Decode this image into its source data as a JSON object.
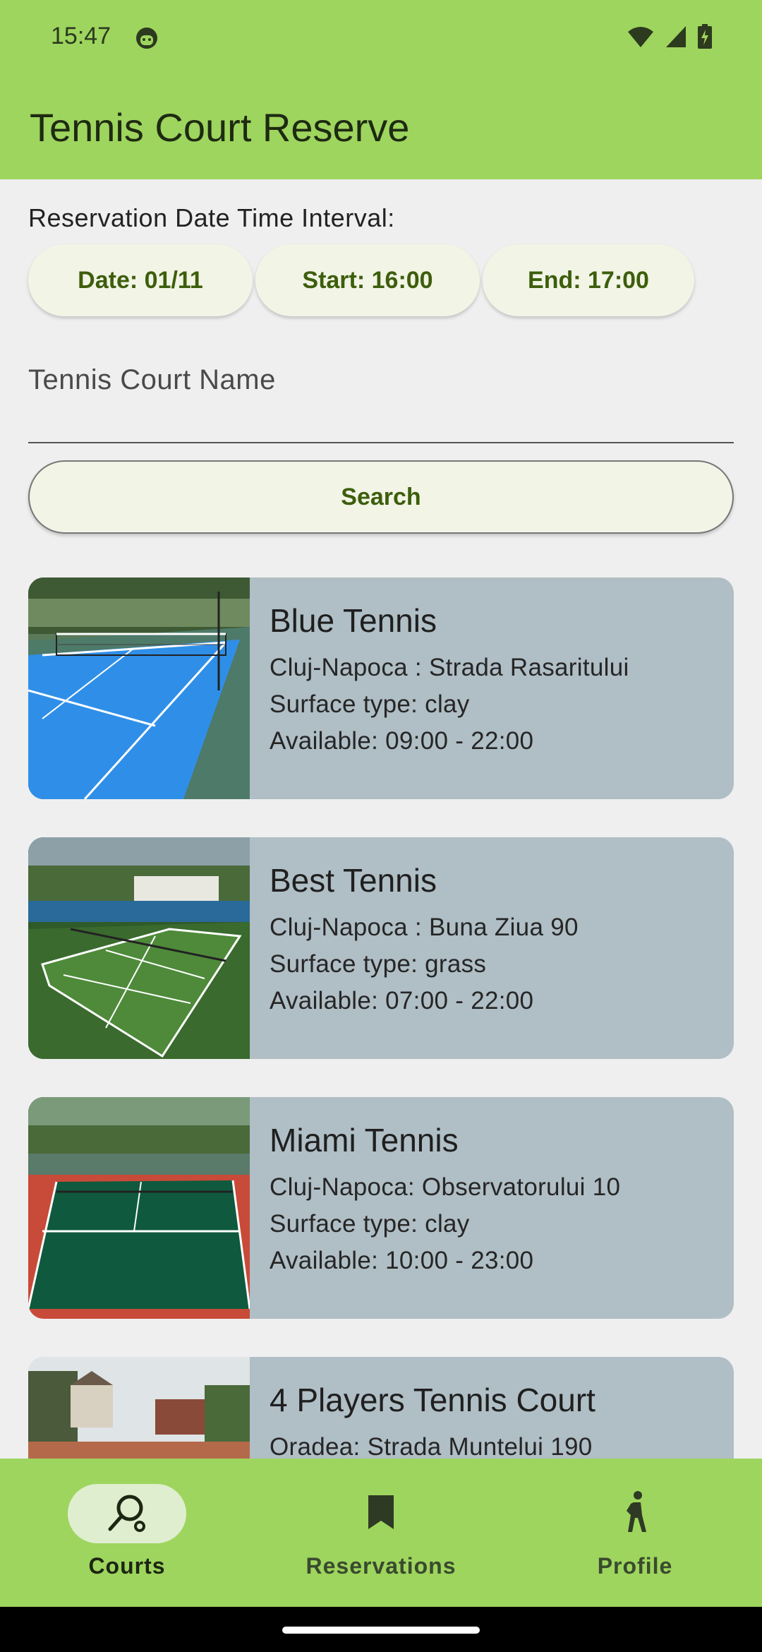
{
  "status_bar": {
    "time": "15:47",
    "icons": [
      "face-icon",
      "wifi-icon",
      "signal-icon",
      "battery-charging-icon"
    ]
  },
  "app_bar": {
    "title": "Tennis Court Reserve"
  },
  "filters": {
    "interval_label": "Reservation Date Time Interval:",
    "date_chip": "Date: 01/11",
    "start_chip": "Start: 16:00",
    "end_chip": "End: 17:00",
    "name_field_label": "Tennis Court Name",
    "name_field_value": "",
    "search_label": "Search"
  },
  "courts": [
    {
      "name": "Blue Tennis",
      "address": "Cluj-Napoca : Strada Rasaritului",
      "surface": "Surface type: clay",
      "available": "Available: 09:00 - 22:00",
      "image": "blue-court-photo"
    },
    {
      "name": "Best Tennis",
      "address": "Cluj-Napoca : Buna Ziua 90",
      "surface": "Surface type: grass",
      "available": "Available: 07:00 - 22:00",
      "image": "green-court-photo"
    },
    {
      "name": "Miami Tennis",
      "address": "Cluj-Napoca: Observatorului 10",
      "surface": "Surface type: clay",
      "available": "Available: 10:00 - 23:00",
      "image": "red-green-court-photo"
    },
    {
      "name": "4 Players Tennis Court",
      "address": "Oradea: Strada Muntelui 190",
      "surface": "",
      "available": "",
      "image": "village-court-photo"
    }
  ],
  "bottom_nav": {
    "items": [
      {
        "label": "Courts",
        "icon": "search-icon",
        "active": true
      },
      {
        "label": "Reservations",
        "icon": "bookmark-icon",
        "active": false
      },
      {
        "label": "Profile",
        "icon": "person-walking-icon",
        "active": false
      }
    ]
  },
  "colors": {
    "brand_green": "#9ed55e",
    "chip_bg": "#f2f4e6",
    "chip_text": "#3d5e0c",
    "card_bg": "#b0bec5"
  }
}
